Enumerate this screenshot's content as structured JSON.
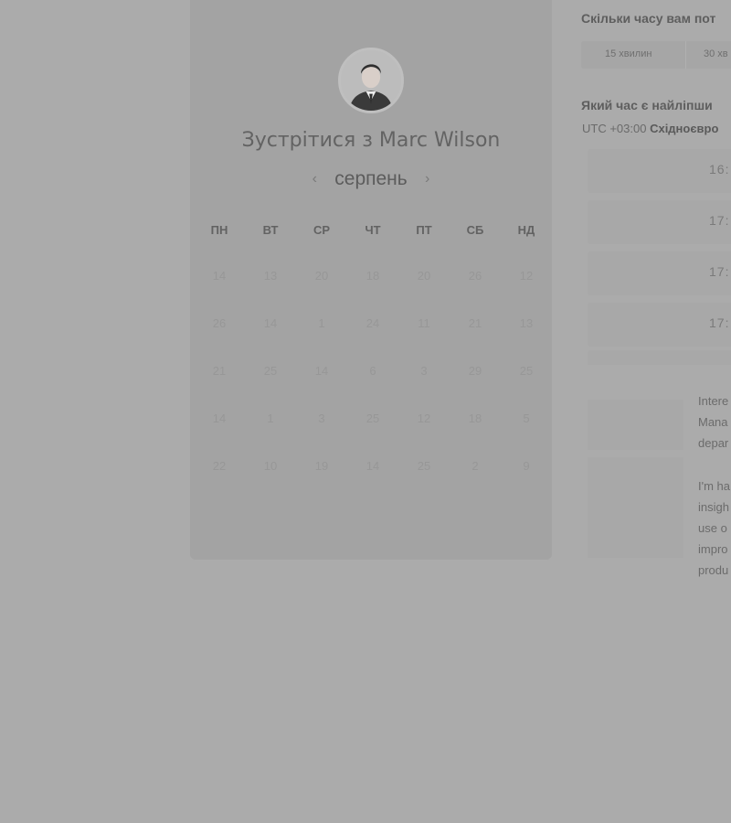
{
  "booking": {
    "avatar_icon": "person-photo-icon",
    "title": "Зустрітися з Marc Wilson",
    "month": "серпень",
    "prev_icon": "‹",
    "next_icon": "›",
    "weekdays": [
      "ПН",
      "ВТ",
      "СР",
      "ЧТ",
      "ПТ",
      "СБ",
      "НД"
    ],
    "days": [
      [
        "14",
        "13",
        "20",
        "18",
        "20",
        "26",
        "12"
      ],
      [
        "26",
        "14",
        "1",
        "24",
        "11",
        "21",
        "13"
      ],
      [
        "21",
        "25",
        "14",
        "6",
        "3",
        "29",
        "25"
      ],
      [
        "14",
        "1",
        "3",
        "25",
        "12",
        "18",
        "5"
      ],
      [
        "22",
        "10",
        "19",
        "14",
        "25",
        "2",
        "9"
      ]
    ]
  },
  "duration": {
    "question": "Скільки часу вам пот",
    "options": [
      "15 хвилин",
      "30 хв"
    ]
  },
  "timeslots": {
    "question": "Який час є найліпши",
    "timezone_prefix": "UTC +03:00",
    "timezone_name": "Східноєвро",
    "slots": [
      "16:",
      "17:",
      "17:",
      "17:"
    ]
  },
  "description": {
    "paragraph1": [
      "Intere",
      "Mana",
      "depar"
    ],
    "paragraph2": [
      "I'm ha",
      "insigh",
      "use o",
      "impro",
      "produ"
    ]
  },
  "colors": {
    "overlay": "#ababab",
    "card": "#a3a3a3"
  }
}
